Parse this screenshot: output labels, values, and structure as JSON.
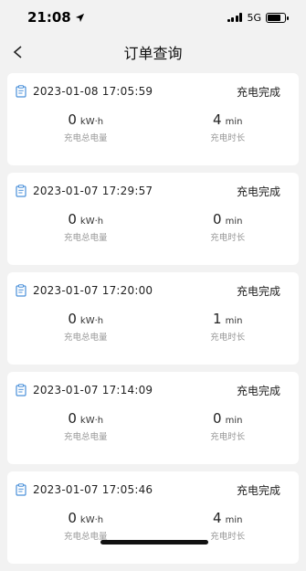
{
  "status_bar": {
    "time": "21:08",
    "network": "5G",
    "battery_level": 0.8
  },
  "header": {
    "title": "订单查询"
  },
  "orders": [
    {
      "time": "2023-01-08 17:05:59",
      "status": "充电完成",
      "energy_value": "0",
      "energy_unit": "kW·h",
      "energy_label": "充电总电量",
      "duration_value": "4",
      "duration_unit": "min",
      "duration_label": "充电时长"
    },
    {
      "time": "2023-01-07 17:29:57",
      "status": "充电完成",
      "energy_value": "0",
      "energy_unit": "kW·h",
      "energy_label": "充电总电量",
      "duration_value": "0",
      "duration_unit": "min",
      "duration_label": "充电时长"
    },
    {
      "time": "2023-01-07 17:20:00",
      "status": "充电完成",
      "energy_value": "0",
      "energy_unit": "kW·h",
      "energy_label": "充电总电量",
      "duration_value": "1",
      "duration_unit": "min",
      "duration_label": "充电时长"
    },
    {
      "time": "2023-01-07 17:14:09",
      "status": "充电完成",
      "energy_value": "0",
      "energy_unit": "kW·h",
      "energy_label": "充电总电量",
      "duration_value": "0",
      "duration_unit": "min",
      "duration_label": "充电时长"
    },
    {
      "time": "2023-01-07 17:05:46",
      "status": "充电完成",
      "energy_value": "0",
      "energy_unit": "kW·h",
      "energy_label": "充电总电量",
      "duration_value": "4",
      "duration_unit": "min",
      "duration_label": "充电时长"
    }
  ],
  "colors": {
    "background": "#f2f2f2",
    "card": "#ffffff",
    "icon_accent": "#4a90d9",
    "label_gray": "#999999"
  }
}
